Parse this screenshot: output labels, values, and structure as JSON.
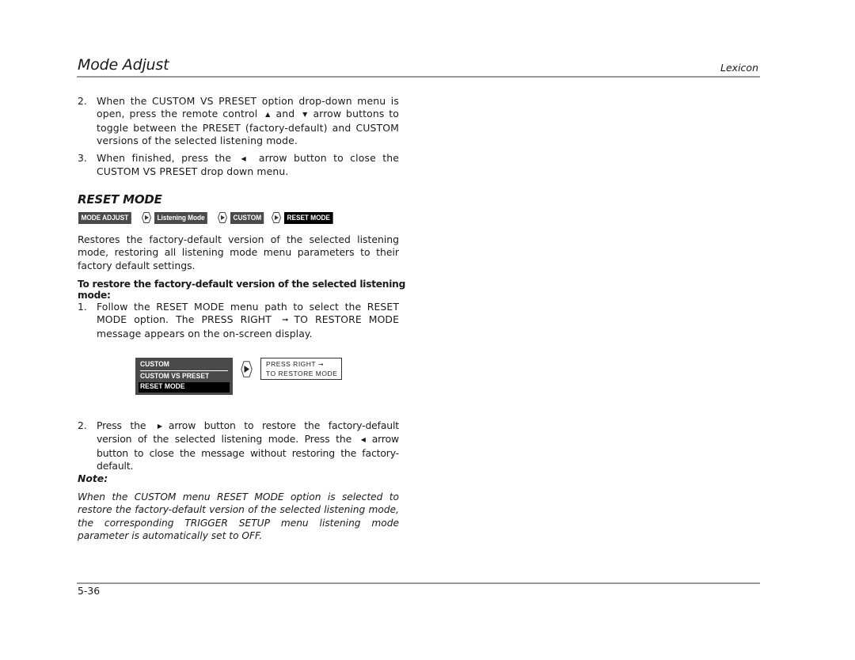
{
  "header": {
    "title": "Mode Adjust",
    "brand": "Lexicon"
  },
  "steps_top": [
    {
      "number": "2.",
      "parts": [
        "When the CUSTOM VS PRESET option drop-down menu is open, press the remote control",
        "and",
        "arrow buttons to toggle between the PRESET (factory-default) and CUSTOM versions of the selected listening mode."
      ],
      "icons": [
        "up-arrow-icon",
        "down-arrow-icon"
      ]
    },
    {
      "number": "3.",
      "parts": [
        "When finished, press the",
        "arrow button to close the CUSTOM VS PRESET drop down menu."
      ],
      "icons": [
        "left-arrow-icon"
      ]
    }
  ],
  "section": {
    "heading": "RESET MODE",
    "menu_path": [
      {
        "label": "MODE ADJUST",
        "active": false
      },
      {
        "label": "Listening Mode",
        "active": false
      },
      {
        "label": "CUSTOM",
        "active": false
      },
      {
        "label": "RESET MODE",
        "active": true
      }
    ],
    "description": "Restores the factory-default version of the selected listening mode, restoring all listening mode menu parameters to their factory default settings.",
    "procedure_heading": "To restore the factory-default version of the selected listening mode:",
    "step1": {
      "number": "1.",
      "before": "Follow the RESET MODE menu path to select the RESET MODE option. The PRESS RIGHT",
      "after": "TO RESTORE MODE message appears on the on-screen display."
    },
    "osd": {
      "menu_title": "CUSTOM",
      "menu_items": [
        "CUSTOM VS PRESET",
        "RESET MODE"
      ],
      "selected_item": "RESET MODE",
      "message_line1": "PRESS RIGHT",
      "message_line2": "TO RESTORE MODE"
    },
    "step2": {
      "number": "2.",
      "part1": "Press the",
      "part2": "arrow button to restore the factory-default version of the selected listening mode. Press the",
      "part3": "arrow button to close the message without restoring the factory-default."
    }
  },
  "note": {
    "label": "Note:",
    "body": "When the CUSTOM menu RESET MODE option is selected to restore the factory-default version of the selected listening mode, the corresponding TRIGGER SETUP menu listening mode parameter is automatically set to OFF."
  },
  "footer": {
    "page_number": "5-36"
  },
  "glyphs": {
    "up": "▲",
    "down": "▼",
    "left": "◀",
    "right": "▶",
    "right_arrow": "➞"
  }
}
